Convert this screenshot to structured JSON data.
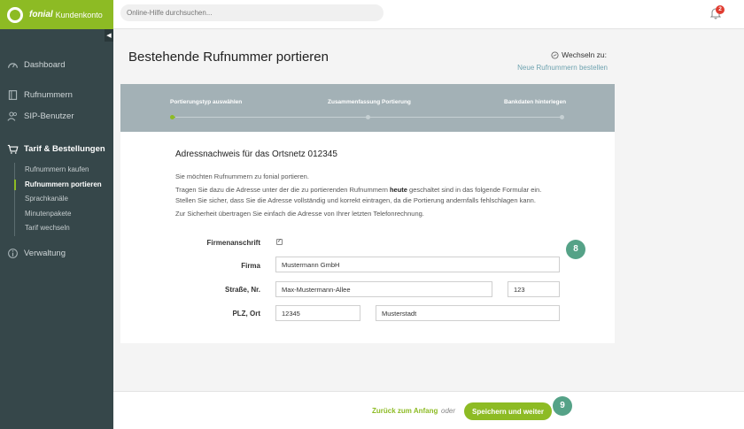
{
  "brand": {
    "name": "fonial",
    "sub": "Kundenkonto"
  },
  "search": {
    "placeholder": "Online-Hilfe durchsuchen..."
  },
  "notifications": {
    "count": "2"
  },
  "sidebar": {
    "items": [
      {
        "label": "Dashboard",
        "icon": "speedometer-icon"
      },
      {
        "label": "Rufnummern",
        "icon": "phonebook-icon"
      },
      {
        "label": "SIP-Benutzer",
        "icon": "users-icon"
      },
      {
        "label": "Tarif & Bestellungen",
        "icon": "cart-icon"
      },
      {
        "label": "Verwaltung",
        "icon": "info-icon"
      }
    ],
    "subitems": [
      "Rufnummern kaufen",
      "Rufnummern portieren",
      "Sprachkanäle",
      "Minutenpakete",
      "Tarif wechseln"
    ],
    "active_subitem": "Rufnummern portieren"
  },
  "page": {
    "title": "Bestehende Rufnummer portieren",
    "switch_label": "Wechseln zu:",
    "switch_link": "Neue Rufnummern bestellen"
  },
  "stepper": {
    "steps": [
      "Portierungstyp auswählen",
      "Zusammenfassung Portierung",
      "Bankdaten hinterlegen"
    ],
    "current_step": 1
  },
  "section": {
    "title": "Adressnachweis für das Ortsnetz 012345",
    "p1": "Sie möchten Rufnummern zu fonial portieren.",
    "p2_before": "Tragen Sie dazu die Adresse unter der die zu portierenden Rufnummern ",
    "p2_bold": "heute",
    "p2_after": " geschaltet sind in das folgende Formular ein.",
    "p3": "Stellen Sie sicher, dass Sie die Adresse vollständig und korrekt eintragen, da die Portierung andernfalls fehlschlagen kann.",
    "p4": "Zur Sicherheit übertragen Sie einfach die Adresse von Ihrer letzten Telefonrechnung."
  },
  "form": {
    "firmenanschrift_label": "Firmenanschrift",
    "firmenanschrift_checked": true,
    "firma_label": "Firma",
    "firma_value": "Mustermann GmbH",
    "strasse_label": "Straße, Nr.",
    "strasse_value": "Max-Mustermann-Allee",
    "nr_value": "123",
    "plz_label": "PLZ, Ort",
    "plz_value": "12345",
    "ort_value": "Musterstadt"
  },
  "badges": {
    "form_step": "8",
    "submit_step": "9"
  },
  "footer": {
    "back_label": "Zurück zum Anfang",
    "or_label": "oder",
    "save_label": "Speichern und weiter"
  },
  "colors": {
    "accent": "#8dbb24",
    "sidebar": "#36474a",
    "stepper": "#a3b1b6",
    "badge": "#55a287"
  }
}
